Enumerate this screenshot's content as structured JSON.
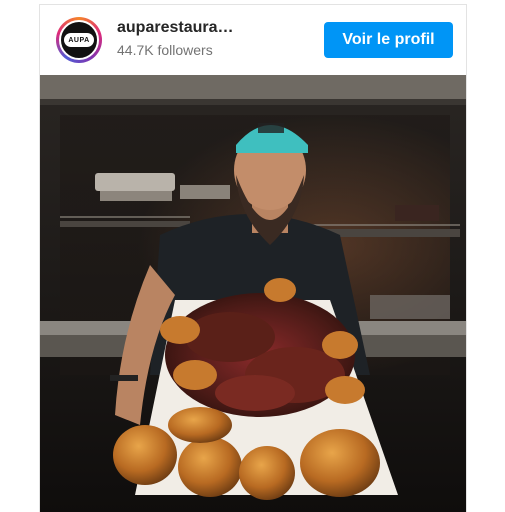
{
  "post": {
    "username": "auparestaura…",
    "followers": "44.7K followers",
    "profile_button_label": "Voir le profil",
    "avatar_text": "AUPA",
    "accent_color": "#0095f6",
    "photo_subject": "chef-holding-tray-of-grilled-meat"
  }
}
